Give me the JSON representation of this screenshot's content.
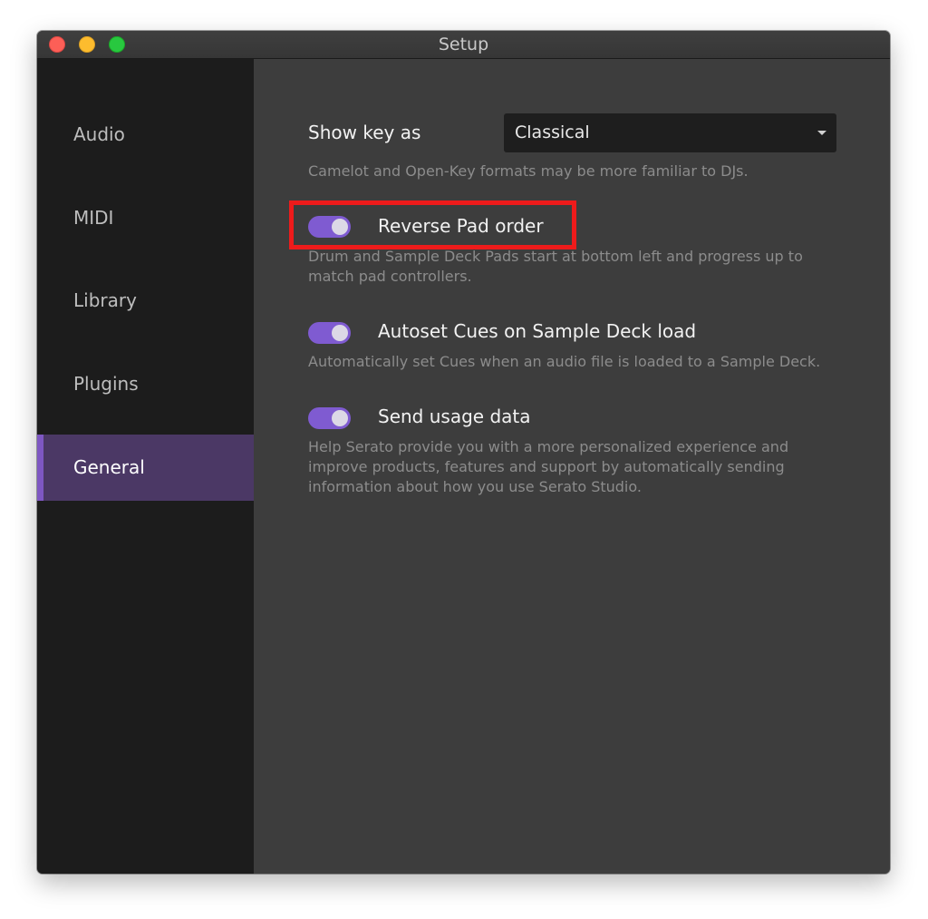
{
  "window": {
    "title": "Setup"
  },
  "sidebar": {
    "items": [
      {
        "label": "Audio",
        "active": false
      },
      {
        "label": "MIDI",
        "active": false
      },
      {
        "label": "Library",
        "active": false
      },
      {
        "label": "Plugins",
        "active": false
      },
      {
        "label": "General",
        "active": true
      }
    ]
  },
  "general": {
    "show_key": {
      "label": "Show key as",
      "selected": "Classical",
      "description": "Camelot and Open-Key formats may be more familiar to DJs."
    },
    "reverse_pad": {
      "label": "Reverse Pad order",
      "enabled": true,
      "description": "Drum and Sample Deck Pads start at bottom left and progress up to match pad controllers."
    },
    "autoset_cues": {
      "label": "Autoset Cues on Sample Deck load",
      "enabled": true,
      "description": "Automatically set Cues when an audio file is loaded to a Sample Deck."
    },
    "usage_data": {
      "label": "Send usage data",
      "enabled": true,
      "description": "Help Serato provide you with a more personalized experience and improve products, features and support by automatically sending information about how you use Serato Studio."
    }
  },
  "colors": {
    "accent": "#7f5bd1",
    "active_item": "#4b3865",
    "highlight": "#ee1b1b"
  }
}
